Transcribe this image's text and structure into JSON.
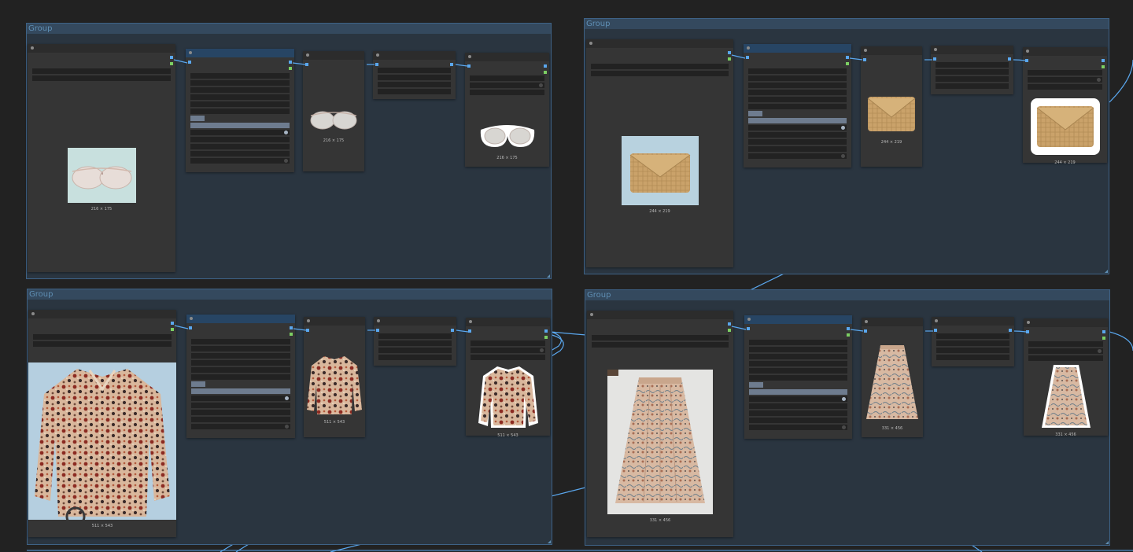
{
  "canvas": {
    "background": "#222222",
    "link_color": "#5aa7ee"
  },
  "groups": [
    {
      "id": "glasses",
      "title": "Group",
      "previews": {
        "source": "216 × 175",
        "resized": "216 × 175",
        "cutout": "216 × 175"
      }
    },
    {
      "id": "clutch",
      "title": "Group",
      "previews": {
        "source": "244 × 219",
        "resized": "244 × 219",
        "cutout": "244 × 219"
      }
    },
    {
      "id": "blouse",
      "title": "Group",
      "previews": {
        "source": "511 × 543",
        "resized": "511 × 543",
        "cutout": "511 × 543"
      }
    },
    {
      "id": "skirt",
      "title": "Group",
      "previews": {
        "source": "331 × 456",
        "resized": "331 × 456",
        "cutout": "331 × 456"
      }
    }
  ],
  "icons": {
    "preview_glasses": "sunglasses-icon",
    "preview_clutch": "straw-clutch-icon",
    "preview_blouse": "floral-blouse-icon",
    "preview_skirt": "floral-skirt-icon"
  }
}
